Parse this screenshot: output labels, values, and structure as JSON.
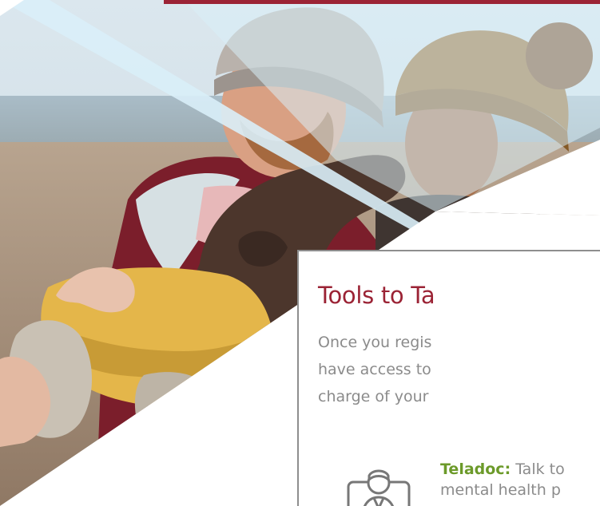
{
  "card": {
    "title": "Tools to Ta",
    "intro_lines": [
      "Once you regis",
      "have access to",
      "charge of your"
    ]
  },
  "tool": {
    "name": "Teladoc:",
    "text_line1": " Talk to",
    "text_line2": "mental health p",
    "icon": "doctor-video-call-icon"
  },
  "colors": {
    "accent": "#9b2335",
    "tool_name": "#6c9a2a",
    "body_text": "#8b8b8b",
    "card_border": "#8e8e8e"
  }
}
